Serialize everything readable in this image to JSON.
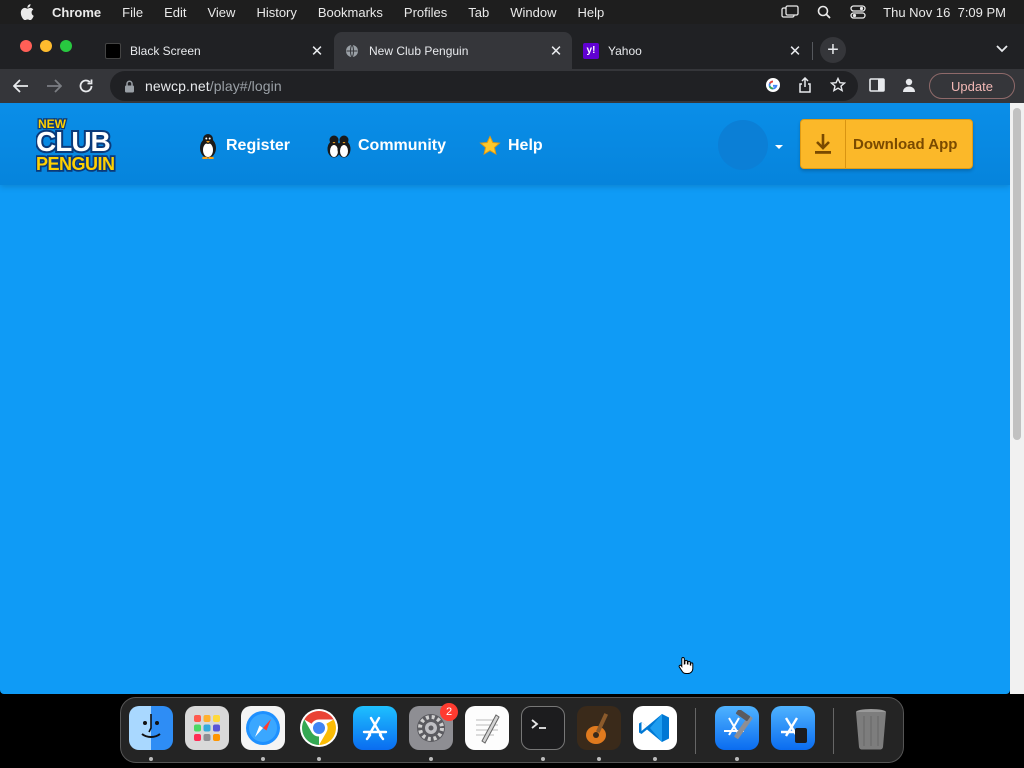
{
  "menubar": {
    "app_name": "Chrome",
    "items": [
      "File",
      "Edit",
      "View",
      "History",
      "Bookmarks",
      "Profiles",
      "Tab",
      "Window",
      "Help"
    ],
    "clock": "Thu Nov 16  7:09 PM"
  },
  "tabs": [
    {
      "title": "Black Screen",
      "favicon": "black-square-icon",
      "active": false
    },
    {
      "title": "New Club Penguin",
      "favicon": "globe-icon",
      "active": true
    },
    {
      "title": "Yahoo",
      "favicon": "yahoo-icon",
      "active": false
    }
  ],
  "toolbar": {
    "url_host": "newcp.net",
    "url_path": "/play#/login",
    "update_label": "Update"
  },
  "site": {
    "logo_top": "NEW",
    "logo_mid": "CLUB",
    "logo_bottom": "PENGUIN",
    "nav": [
      {
        "label": "Register",
        "icon": "penguin-icon"
      },
      {
        "label": "Community",
        "icon": "penguins-icon"
      },
      {
        "label": "Help",
        "icon": "star-icon"
      }
    ],
    "download_label": "Download App"
  },
  "dock": {
    "apps": [
      "Finder",
      "Launchpad",
      "Safari",
      "Chrome",
      "App Store",
      "System Settings",
      "TextEdit",
      "Terminal",
      "GarageBand",
      "Visual Studio Code",
      "Xcode",
      "Simulator",
      "Trash"
    ],
    "settings_badge": "2"
  },
  "colors": {
    "page_bg": "#0f9bf6",
    "nav_bg": "#0a8ee8",
    "download_bg": "#fbb829"
  }
}
